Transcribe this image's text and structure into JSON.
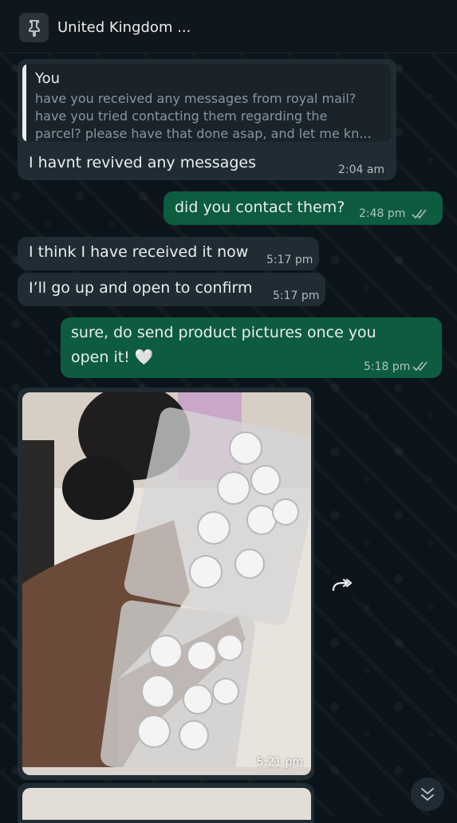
{
  "header": {
    "title": "United Kingdom ...",
    "pin_icon": "pin-icon"
  },
  "colors": {
    "background": "#0b141a",
    "incoming_bubble": "#202c33",
    "outgoing_bubble": "#0d5c3f",
    "read_ticks": "#8696a0"
  },
  "messages": [
    {
      "direction": "incoming",
      "quoted": {
        "author": "You",
        "lines": [
          "have you received any messages from royal mail?",
          "have you tried contacting them regarding the",
          "parcel? please have that done asap, and let me kn..."
        ]
      },
      "text": "I havnt revived any messages",
      "time": "2:04 am"
    },
    {
      "direction": "outgoing",
      "text": "did you contact them?",
      "time": "2:48 pm",
      "status": "read"
    },
    {
      "direction": "incoming",
      "text": "I think I have received it now",
      "time": "5:17 pm"
    },
    {
      "direction": "incoming",
      "text": "I’ll go up and open to confirm",
      "time": "5:17 pm"
    },
    {
      "direction": "outgoing",
      "lines": [
        "sure, do send product pictures once you",
        "open it! 🤍"
      ],
      "time": "5:18 pm",
      "status": "read"
    },
    {
      "direction": "incoming",
      "type": "image",
      "time": "5:21 pm"
    }
  ],
  "actions": {
    "forward_icon": "forward-icon",
    "scroll_down_icon": "double-chevron-down-icon"
  }
}
